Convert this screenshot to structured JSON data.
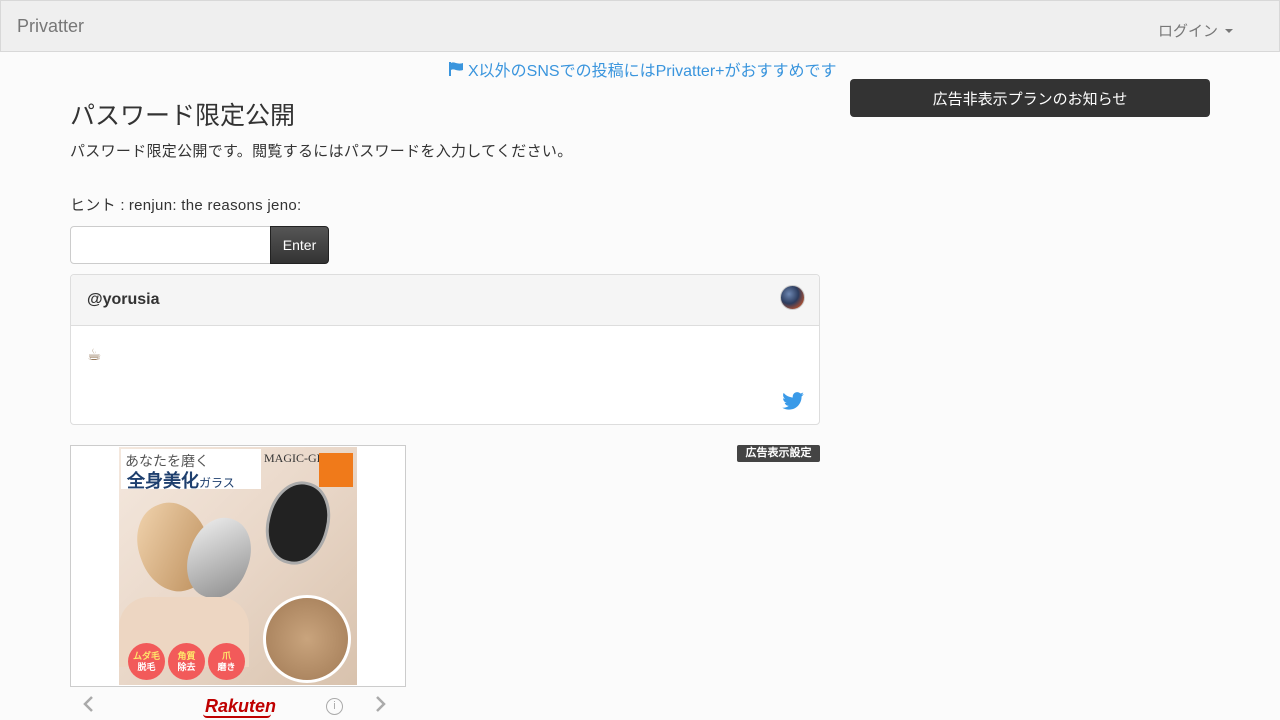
{
  "navbar": {
    "brand": "Privatter",
    "login_label": "ログイン"
  },
  "promo": {
    "text": "X以外のSNSでの投稿にはPrivatter+がおすすめです",
    "icon": "flag-icon",
    "color": "#3a95dd"
  },
  "main": {
    "title": "パスワード限定公開",
    "description": "パスワード限定公開です。閲覧するにはパスワードを入力してください。",
    "hint_label": "ヒント :",
    "hint_text": "renjun: the reasons jeno:",
    "password": {
      "value": "",
      "placeholder": ""
    },
    "enter_label": "Enter"
  },
  "post": {
    "author": "@yorusia",
    "body": "☕",
    "avatar_icon": "avatar-image",
    "share_icon": "twitter-bird-icon"
  },
  "ad": {
    "image": {
      "line1": "あなたを磨く",
      "line2_main": "全身美化",
      "line2_small": "ガラス",
      "product_name": "MAGIC-GLASS",
      "badges": [
        {
          "top": "ムダ毛",
          "bottom": "脱毛"
        },
        {
          "top": "角質",
          "bottom": "除去"
        },
        {
          "top": "爪",
          "bottom": "磨き"
        }
      ]
    },
    "footer": {
      "logo": "Rakuten",
      "info_icon": "info-icon",
      "prev_icon": "chevron-left-icon",
      "next_icon": "chevron-right-icon"
    },
    "settings_label": "広告表示設定"
  },
  "sidebar": {
    "notice_label": "広告非表示プランのお知らせ"
  }
}
